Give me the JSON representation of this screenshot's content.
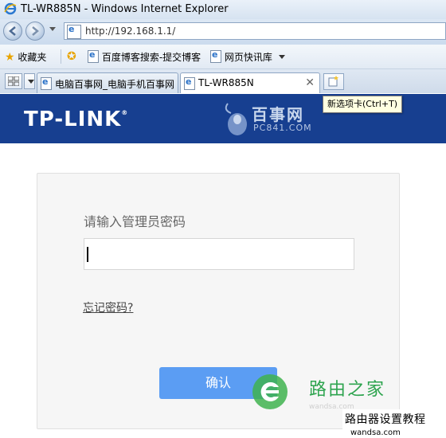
{
  "window": {
    "title": "TL-WR885N - Windows Internet Explorer"
  },
  "address_bar": {
    "url": "http://192.168.1.1/"
  },
  "favorites_bar": {
    "favorites_label": "收藏夹",
    "items": [
      {
        "label": "百度博客搜索-提交博客",
        "icon": "ie-page-icon"
      },
      {
        "label": "网页快讯库",
        "icon": "feed-icon"
      }
    ]
  },
  "tabs": [
    {
      "label": "电脑百事网_电脑手机百事网",
      "active": false
    },
    {
      "label": "TL-WR885N",
      "active": true
    }
  ],
  "new_tab_tooltip": "新选项卡(Ctrl+T)",
  "page": {
    "brand": "TP-LINK",
    "brand_mark": "®",
    "watermark_top": {
      "cn": "百事网",
      "en": "PC841.COM"
    },
    "login": {
      "prompt": "请输入管理员密码",
      "password_value": "",
      "forgot_link": "忘记密码?",
      "confirm_button": "确认"
    }
  },
  "watermark_bottom": {
    "name": "路由之家",
    "site": "wandsa.com",
    "caption": "路由器设置教程",
    "caption_site": "wandsa.com"
  },
  "colors": {
    "banner": "#173f90",
    "confirm_button": "#5b9df3",
    "card_background": "#f6f6f6"
  }
}
